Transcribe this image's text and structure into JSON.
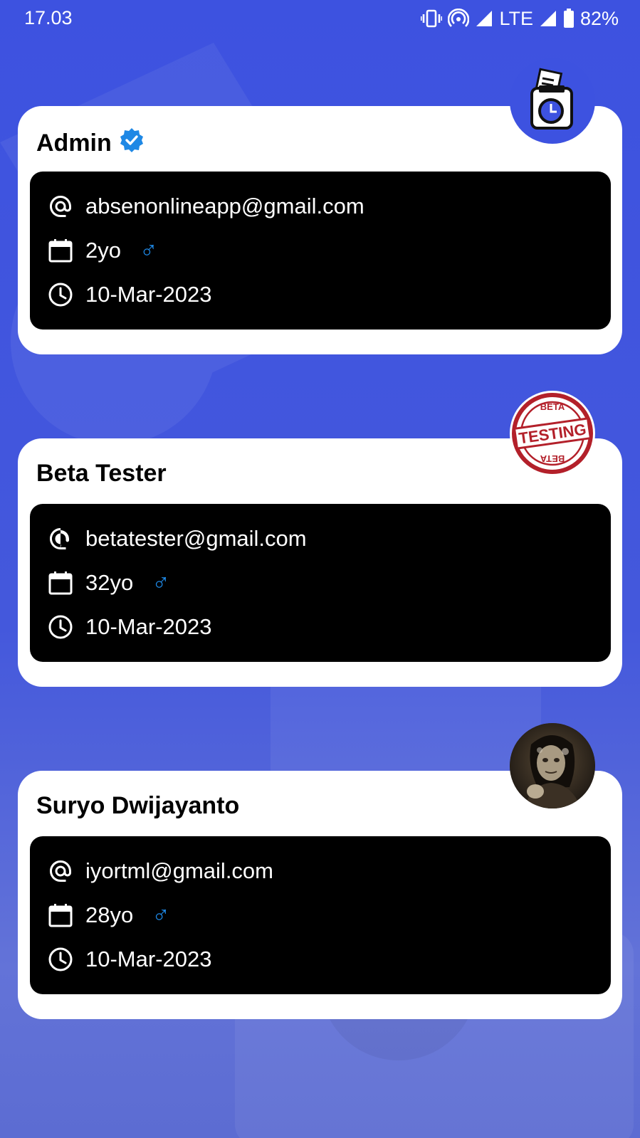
{
  "status_bar": {
    "time": "17.03",
    "network": "LTE",
    "battery": "82%"
  },
  "users": [
    {
      "name": "Admin",
      "verified": true,
      "email": "absenonlineapp@gmail.com",
      "age": "2yo",
      "gender_symbol": "♂",
      "date": "10-Mar-2023",
      "badge_icon": "attendance-app-logo-icon"
    },
    {
      "name": "Beta Tester",
      "verified": false,
      "email": "betatester@gmail.com",
      "age": "32yo",
      "gender_symbol": "♂",
      "date": "10-Mar-2023",
      "badge_icon": "beta-testing-stamp-icon",
      "badge_text_top": "BETA",
      "badge_text_main": "TESTING",
      "badge_text_bottom": "BETA"
    },
    {
      "name": "Suryo Dwijayanto",
      "verified": false,
      "email": "iyortml@gmail.com",
      "age": "28yo",
      "gender_symbol": "♂",
      "date": "10-Mar-2023",
      "badge_icon": "user-avatar-photo"
    }
  ],
  "colors": {
    "background": "#3d52e0",
    "card": "#ffffff",
    "info_box": "#000000",
    "verified": "#1e88e5",
    "gender": "#1e88e5",
    "stamp": "#b3202a"
  },
  "icons": {
    "email": "at-sign-icon",
    "age": "calendar-icon",
    "date": "clock-icon"
  }
}
